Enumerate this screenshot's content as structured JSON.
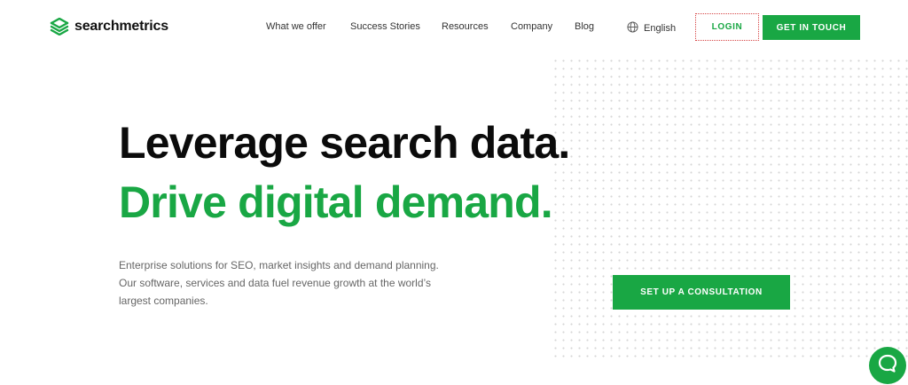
{
  "brand": {
    "name": "searchmetrics",
    "accent": "#19a744"
  },
  "nav": {
    "items": [
      "What we offer",
      "Success Stories",
      "Resources",
      "Company",
      "Blog"
    ],
    "language": "English",
    "login": "LOGIN",
    "contact": "GET IN TOUCH"
  },
  "hero": {
    "headline_1": "Leverage search data.",
    "headline_2": "Drive digital demand.",
    "body": "Enterprise solutions for SEO, market insights and demand planning. Our software, services and data fuel revenue growth at the world’s largest companies.",
    "cta": "SET UP A CONSULTATION"
  },
  "icons": {
    "logo": "searchmetrics-logo-icon",
    "language": "globe-icon",
    "chat": "chat-bubble-icon"
  }
}
